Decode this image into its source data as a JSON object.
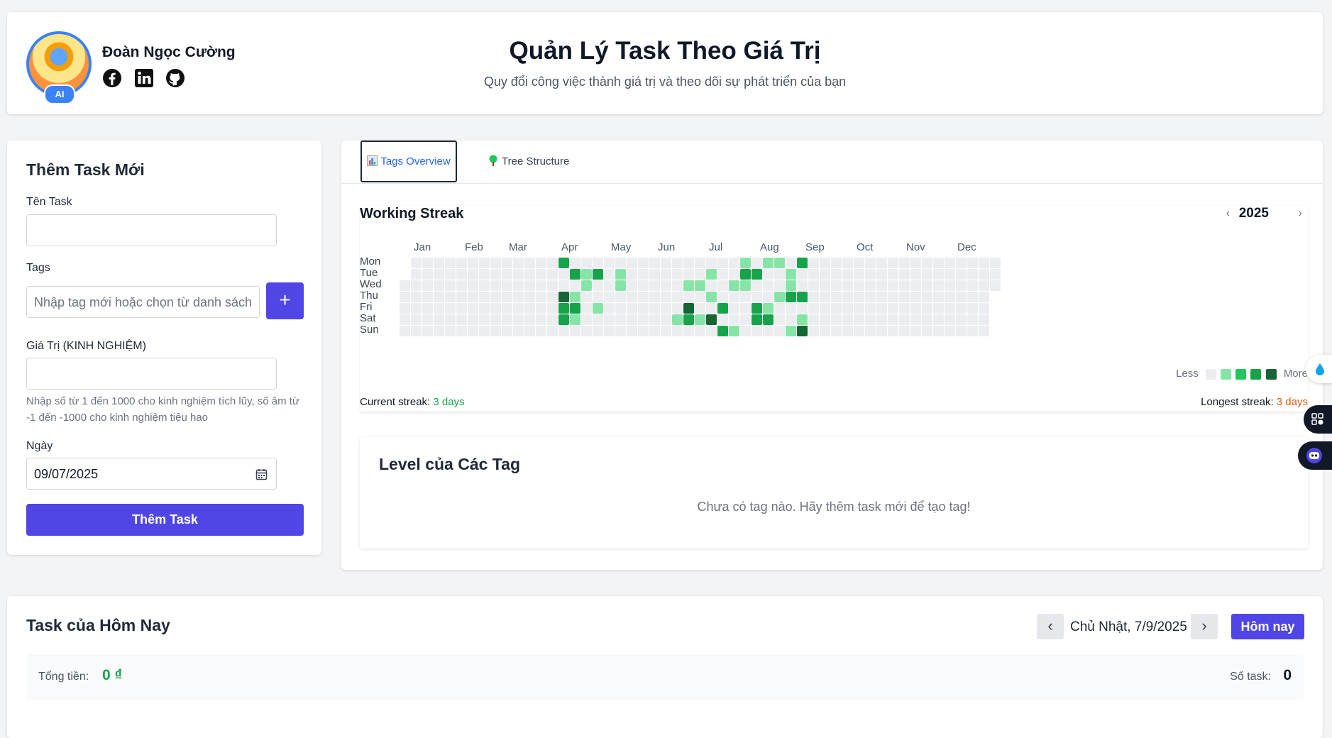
{
  "header": {
    "author_name": "Đoàn Ngọc Cường",
    "ai_badge": "AI",
    "title": "Quản Lý Task Theo Giá Trị",
    "subtitle": "Quy đổi công việc thành giá trị và theo dõi sự phát triển của bạn",
    "social_icons": [
      "facebook-icon",
      "linkedin-icon",
      "github-icon"
    ]
  },
  "form": {
    "title": "Thêm Task Mới",
    "task_name_label": "Tên Task",
    "task_name_value": "",
    "tags_label": "Tags",
    "tags_placeholder": "Nhập tag mới hoặc chọn từ danh sách",
    "add_tag_label": "+",
    "value_label": "Giá Trị (KINH NGHIỆM)",
    "value_value": "",
    "value_hint": "Nhập số từ 1 đến 1000 cho kinh nghiệm tích lũy, số âm từ -1 đến -1000 cho kinh nghiệm tiêu hao",
    "date_label": "Ngày",
    "date_value": "09/07/2025",
    "submit_label": "Thêm Task"
  },
  "tabs": [
    {
      "label": "Tags Overview",
      "icon": "bar-chart-icon",
      "active": true
    },
    {
      "label": "Tree Structure",
      "icon": "tree-icon",
      "active": false
    }
  ],
  "streak": {
    "title": "Working Streak",
    "year": "2025",
    "prev": "‹",
    "next": "›",
    "months": [
      "Jan",
      "Feb",
      "Mar",
      "Apr",
      "May",
      "Jun",
      "Jul",
      "Aug",
      "Sep",
      "Oct",
      "Nov",
      "Dec"
    ],
    "days": [
      "Mon",
      "Tue",
      "Wed",
      "Thu",
      "Fri",
      "Sat",
      "Sun"
    ],
    "legend_less": "Less",
    "legend_more": "More",
    "current_label": "Current streak:",
    "current_value": "3 days",
    "longest_label": "Longest streak:",
    "longest_value": "3 days",
    "colors": [
      "#ebedf0",
      "#86e5a6",
      "#22c55e",
      "#16a34a",
      "#166534"
    ],
    "active_days": [
      {
        "w": 14,
        "d": 0,
        "l": 3
      },
      {
        "w": 30,
        "d": 0,
        "l": 1
      },
      {
        "w": 32,
        "d": 0,
        "l": 1
      },
      {
        "w": 33,
        "d": 0,
        "l": 1
      },
      {
        "w": 35,
        "d": 0,
        "l": 3
      },
      {
        "w": 15,
        "d": 1,
        "l": 3
      },
      {
        "w": 16,
        "d": 1,
        "l": 1
      },
      {
        "w": 17,
        "d": 1,
        "l": 3
      },
      {
        "w": 19,
        "d": 1,
        "l": 1
      },
      {
        "w": 27,
        "d": 1,
        "l": 1
      },
      {
        "w": 30,
        "d": 1,
        "l": 3
      },
      {
        "w": 31,
        "d": 1,
        "l": 3
      },
      {
        "w": 34,
        "d": 1,
        "l": 1
      },
      {
        "w": 16,
        "d": 2,
        "l": 1
      },
      {
        "w": 19,
        "d": 2,
        "l": 1
      },
      {
        "w": 25,
        "d": 2,
        "l": 1
      },
      {
        "w": 26,
        "d": 2,
        "l": 1
      },
      {
        "w": 29,
        "d": 2,
        "l": 1
      },
      {
        "w": 30,
        "d": 2,
        "l": 1
      },
      {
        "w": 34,
        "d": 2,
        "l": 1
      },
      {
        "w": 14,
        "d": 3,
        "l": 4
      },
      {
        "w": 15,
        "d": 3,
        "l": 1
      },
      {
        "w": 27,
        "d": 3,
        "l": 1
      },
      {
        "w": 33,
        "d": 3,
        "l": 1
      },
      {
        "w": 34,
        "d": 3,
        "l": 3
      },
      {
        "w": 35,
        "d": 3,
        "l": 3
      },
      {
        "w": 14,
        "d": 4,
        "l": 3
      },
      {
        "w": 15,
        "d": 4,
        "l": 3
      },
      {
        "w": 17,
        "d": 4,
        "l": 1
      },
      {
        "w": 25,
        "d": 4,
        "l": 4
      },
      {
        "w": 28,
        "d": 4,
        "l": 3
      },
      {
        "w": 31,
        "d": 4,
        "l": 3
      },
      {
        "w": 32,
        "d": 4,
        "l": 1
      },
      {
        "w": 14,
        "d": 5,
        "l": 3
      },
      {
        "w": 15,
        "d": 5,
        "l": 1
      },
      {
        "w": 24,
        "d": 5,
        "l": 1
      },
      {
        "w": 25,
        "d": 5,
        "l": 3
      },
      {
        "w": 26,
        "d": 5,
        "l": 1
      },
      {
        "w": 27,
        "d": 5,
        "l": 4
      },
      {
        "w": 31,
        "d": 5,
        "l": 3
      },
      {
        "w": 32,
        "d": 5,
        "l": 3
      },
      {
        "w": 35,
        "d": 5,
        "l": 1
      },
      {
        "w": 28,
        "d": 6,
        "l": 3
      },
      {
        "w": 29,
        "d": 6,
        "l": 1
      },
      {
        "w": 34,
        "d": 6,
        "l": 1
      },
      {
        "w": 35,
        "d": 6,
        "l": 4
      }
    ]
  },
  "levels": {
    "title": "Level của Các Tag",
    "empty_message": "Chưa có tag nào. Hãy thêm task mới để tạo tag!"
  },
  "today": {
    "title": "Task của Hôm Nay",
    "prev": "‹",
    "next": "›",
    "date": "Chủ Nhật, 7/9/2025",
    "today_button": "Hôm nay",
    "total_label": "Tổng tiền:",
    "total_value": "0 ₫",
    "count_label": "Số task:",
    "count_value": "0"
  },
  "accent": "#4f46e5",
  "green": "#16a34a",
  "orange": "#ea580c"
}
